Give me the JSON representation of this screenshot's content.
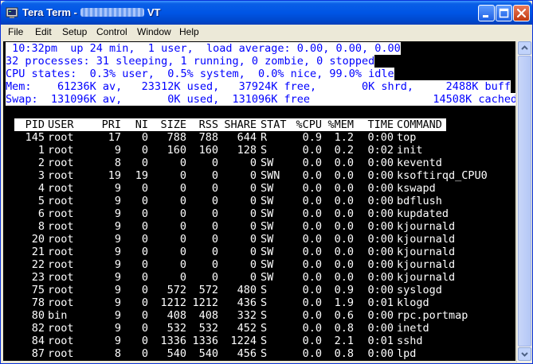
{
  "window": {
    "title_prefix": "Tera Term -",
    "title_suffix": "VT"
  },
  "menu": [
    "File",
    "Edit",
    "Setup",
    "Control",
    "Window",
    "Help"
  ],
  "top_header": {
    "line1": " 10:32pm  up 24 min,  1 user,  load average: 0.00, 0.00, 0.00",
    "line2": "32 processes: 31 sleeping, 1 running, 0 zombie, 0 stopped",
    "line3": "CPU states:  0.3% user,  0.5% system,  0.0% nice, 99.0% idle",
    "line4": "Mem:    61236K av,   23312K used,   37924K free,       0K shrd,     2488K buff",
    "line5": "Swap:  131096K av,       0K used,  131096K free                   14508K cached"
  },
  "table_columns": [
    "PID",
    "USER",
    "PRI",
    "NI",
    "SIZE",
    "RSS",
    "SHARE",
    "STAT",
    "%CPU",
    "%MEM",
    "TIME",
    "COMMAND"
  ],
  "processes": [
    {
      "pid": "145",
      "user": "root",
      "pri": "17",
      "ni": "0",
      "size": "788",
      "rss": "788",
      "share": "644",
      "stat": "R",
      "cpu": "0.9",
      "mem": "1.2",
      "time": "0:00",
      "cmd": "top"
    },
    {
      "pid": "1",
      "user": "root",
      "pri": "9",
      "ni": "0",
      "size": "160",
      "rss": "160",
      "share": "128",
      "stat": "S",
      "cpu": "0.0",
      "mem": "0.2",
      "time": "0:02",
      "cmd": "init"
    },
    {
      "pid": "2",
      "user": "root",
      "pri": "8",
      "ni": "0",
      "size": "0",
      "rss": "0",
      "share": "0",
      "stat": "SW",
      "cpu": "0.0",
      "mem": "0.0",
      "time": "0:00",
      "cmd": "keventd"
    },
    {
      "pid": "3",
      "user": "root",
      "pri": "19",
      "ni": "19",
      "size": "0",
      "rss": "0",
      "share": "0",
      "stat": "SWN",
      "cpu": "0.0",
      "mem": "0.0",
      "time": "0:00",
      "cmd": "ksoftirqd_CPU0"
    },
    {
      "pid": "4",
      "user": "root",
      "pri": "9",
      "ni": "0",
      "size": "0",
      "rss": "0",
      "share": "0",
      "stat": "SW",
      "cpu": "0.0",
      "mem": "0.0",
      "time": "0:00",
      "cmd": "kswapd"
    },
    {
      "pid": "5",
      "user": "root",
      "pri": "9",
      "ni": "0",
      "size": "0",
      "rss": "0",
      "share": "0",
      "stat": "SW",
      "cpu": "0.0",
      "mem": "0.0",
      "time": "0:00",
      "cmd": "bdflush"
    },
    {
      "pid": "6",
      "user": "root",
      "pri": "9",
      "ni": "0",
      "size": "0",
      "rss": "0",
      "share": "0",
      "stat": "SW",
      "cpu": "0.0",
      "mem": "0.0",
      "time": "0:00",
      "cmd": "kupdated"
    },
    {
      "pid": "8",
      "user": "root",
      "pri": "9",
      "ni": "0",
      "size": "0",
      "rss": "0",
      "share": "0",
      "stat": "SW",
      "cpu": "0.0",
      "mem": "0.0",
      "time": "0:00",
      "cmd": "kjournald"
    },
    {
      "pid": "20",
      "user": "root",
      "pri": "9",
      "ni": "0",
      "size": "0",
      "rss": "0",
      "share": "0",
      "stat": "SW",
      "cpu": "0.0",
      "mem": "0.0",
      "time": "0:00",
      "cmd": "kjournald"
    },
    {
      "pid": "21",
      "user": "root",
      "pri": "9",
      "ni": "0",
      "size": "0",
      "rss": "0",
      "share": "0",
      "stat": "SW",
      "cpu": "0.0",
      "mem": "0.0",
      "time": "0:00",
      "cmd": "kjournald"
    },
    {
      "pid": "22",
      "user": "root",
      "pri": "9",
      "ni": "0",
      "size": "0",
      "rss": "0",
      "share": "0",
      "stat": "SW",
      "cpu": "0.0",
      "mem": "0.0",
      "time": "0:00",
      "cmd": "kjournald"
    },
    {
      "pid": "23",
      "user": "root",
      "pri": "9",
      "ni": "0",
      "size": "0",
      "rss": "0",
      "share": "0",
      "stat": "SW",
      "cpu": "0.0",
      "mem": "0.0",
      "time": "0:00",
      "cmd": "kjournald"
    },
    {
      "pid": "75",
      "user": "root",
      "pri": "9",
      "ni": "0",
      "size": "572",
      "rss": "572",
      "share": "480",
      "stat": "S",
      "cpu": "0.0",
      "mem": "0.9",
      "time": "0:00",
      "cmd": "syslogd"
    },
    {
      "pid": "78",
      "user": "root",
      "pri": "9",
      "ni": "0",
      "size": "1212",
      "rss": "1212",
      "share": "436",
      "stat": "S",
      "cpu": "0.0",
      "mem": "1.9",
      "time": "0:01",
      "cmd": "klogd"
    },
    {
      "pid": "80",
      "user": "bin",
      "pri": "9",
      "ni": "0",
      "size": "408",
      "rss": "408",
      "share": "332",
      "stat": "S",
      "cpu": "0.0",
      "mem": "0.6",
      "time": "0:00",
      "cmd": "rpc.portmap"
    },
    {
      "pid": "82",
      "user": "root",
      "pri": "9",
      "ni": "0",
      "size": "532",
      "rss": "532",
      "share": "452",
      "stat": "S",
      "cpu": "0.0",
      "mem": "0.8",
      "time": "0:00",
      "cmd": "inetd"
    },
    {
      "pid": "84",
      "user": "root",
      "pri": "9",
      "ni": "0",
      "size": "1336",
      "rss": "1336",
      "share": "1224",
      "stat": "S",
      "cpu": "0.0",
      "mem": "2.1",
      "time": "0:01",
      "cmd": "sshd"
    },
    {
      "pid": "87",
      "user": "root",
      "pri": "8",
      "ni": "0",
      "size": "540",
      "rss": "540",
      "share": "456",
      "stat": "S",
      "cpu": "0.0",
      "mem": "0.8",
      "time": "0:00",
      "cmd": "lpd"
    }
  ],
  "colors": {
    "terminal_bg": "#000000",
    "terminal_fg": "#ffffff",
    "highlight_bg": "#ffffff",
    "highlight_fg": "#0000ff",
    "titlebar": "#0055e5"
  },
  "icons": {
    "app": "tera-term-icon",
    "minimize": "minimize-icon",
    "maximize": "maximize-icon",
    "close": "close-icon"
  }
}
